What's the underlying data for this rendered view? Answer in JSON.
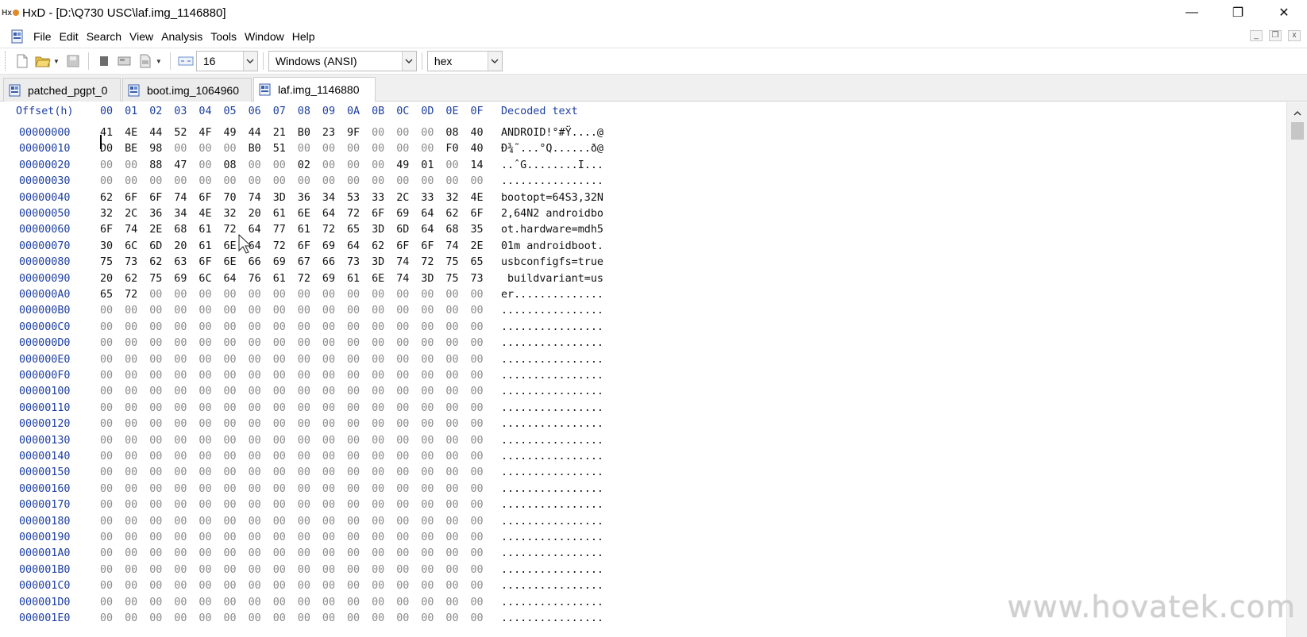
{
  "window": {
    "title": "HxD - [D:\\Q730 USC\\laf.img_1146880]",
    "minimize": "—",
    "restore": "❐",
    "close": "✕"
  },
  "menu": {
    "items": [
      "File",
      "Edit",
      "Search",
      "View",
      "Analysis",
      "Tools",
      "Window",
      "Help"
    ]
  },
  "mdi": {
    "minimize": "_",
    "restore": "❐",
    "close": "x"
  },
  "toolbar": {
    "bytes_per_row": "16",
    "charset": "Windows (ANSI)",
    "offset_base": "hex"
  },
  "tabs": [
    {
      "label": "patched_pgpt_0"
    },
    {
      "label": "boot.img_1064960"
    },
    {
      "label": "laf.img_1146880"
    }
  ],
  "hex": {
    "header_offset": "Offset(h)",
    "header_columns": [
      "00",
      "01",
      "02",
      "03",
      "04",
      "05",
      "06",
      "07",
      "08",
      "09",
      "0A",
      "0B",
      "0C",
      "0D",
      "0E",
      "0F"
    ],
    "header_decoded": "Decoded text",
    "rows": [
      {
        "off": "00000000",
        "bytes": [
          "41",
          "4E",
          "44",
          "52",
          "4F",
          "49",
          "44",
          "21",
          "B0",
          "23",
          "9F",
          "00",
          "00",
          "00",
          "08",
          "40"
        ],
        "dec": "ANDROID!°#Ÿ....@"
      },
      {
        "off": "00000010",
        "bytes": [
          "D0",
          "BE",
          "98",
          "00",
          "00",
          "00",
          "B0",
          "51",
          "00",
          "00",
          "00",
          "00",
          "00",
          "00",
          "F0",
          "40"
        ],
        "dec": "Ð¾˜...°Q......ð@"
      },
      {
        "off": "00000020",
        "bytes": [
          "00",
          "00",
          "88",
          "47",
          "00",
          "08",
          "00",
          "00",
          "02",
          "00",
          "00",
          "00",
          "49",
          "01",
          "00",
          "14"
        ],
        "dec": "..ˆG........I..."
      },
      {
        "off": "00000030",
        "bytes": [
          "00",
          "00",
          "00",
          "00",
          "00",
          "00",
          "00",
          "00",
          "00",
          "00",
          "00",
          "00",
          "00",
          "00",
          "00",
          "00"
        ],
        "dec": "................"
      },
      {
        "off": "00000040",
        "bytes": [
          "62",
          "6F",
          "6F",
          "74",
          "6F",
          "70",
          "74",
          "3D",
          "36",
          "34",
          "53",
          "33",
          "2C",
          "33",
          "32",
          "4E"
        ],
        "dec": "bootopt=64S3,32N"
      },
      {
        "off": "00000050",
        "bytes": [
          "32",
          "2C",
          "36",
          "34",
          "4E",
          "32",
          "20",
          "61",
          "6E",
          "64",
          "72",
          "6F",
          "69",
          "64",
          "62",
          "6F"
        ],
        "dec": "2,64N2 androidbo"
      },
      {
        "off": "00000060",
        "bytes": [
          "6F",
          "74",
          "2E",
          "68",
          "61",
          "72",
          "64",
          "77",
          "61",
          "72",
          "65",
          "3D",
          "6D",
          "64",
          "68",
          "35"
        ],
        "dec": "ot.hardware=mdh5"
      },
      {
        "off": "00000070",
        "bytes": [
          "30",
          "6C",
          "6D",
          "20",
          "61",
          "6E",
          "64",
          "72",
          "6F",
          "69",
          "64",
          "62",
          "6F",
          "6F",
          "74",
          "2E"
        ],
        "dec": "01m androidboot."
      },
      {
        "off": "00000080",
        "bytes": [
          "75",
          "73",
          "62",
          "63",
          "6F",
          "6E",
          "66",
          "69",
          "67",
          "66",
          "73",
          "3D",
          "74",
          "72",
          "75",
          "65"
        ],
        "dec": "usbconfigfs=true"
      },
      {
        "off": "00000090",
        "bytes": [
          "20",
          "62",
          "75",
          "69",
          "6C",
          "64",
          "76",
          "61",
          "72",
          "69",
          "61",
          "6E",
          "74",
          "3D",
          "75",
          "73"
        ],
        "dec": " buildvariant=us"
      },
      {
        "off": "000000A0",
        "bytes": [
          "65",
          "72",
          "00",
          "00",
          "00",
          "00",
          "00",
          "00",
          "00",
          "00",
          "00",
          "00",
          "00",
          "00",
          "00",
          "00"
        ],
        "dec": "er.............."
      },
      {
        "off": "000000B0",
        "bytes": [
          "00",
          "00",
          "00",
          "00",
          "00",
          "00",
          "00",
          "00",
          "00",
          "00",
          "00",
          "00",
          "00",
          "00",
          "00",
          "00"
        ],
        "dec": "................"
      },
      {
        "off": "000000C0",
        "bytes": [
          "00",
          "00",
          "00",
          "00",
          "00",
          "00",
          "00",
          "00",
          "00",
          "00",
          "00",
          "00",
          "00",
          "00",
          "00",
          "00"
        ],
        "dec": "................"
      },
      {
        "off": "000000D0",
        "bytes": [
          "00",
          "00",
          "00",
          "00",
          "00",
          "00",
          "00",
          "00",
          "00",
          "00",
          "00",
          "00",
          "00",
          "00",
          "00",
          "00"
        ],
        "dec": "................"
      },
      {
        "off": "000000E0",
        "bytes": [
          "00",
          "00",
          "00",
          "00",
          "00",
          "00",
          "00",
          "00",
          "00",
          "00",
          "00",
          "00",
          "00",
          "00",
          "00",
          "00"
        ],
        "dec": "................"
      },
      {
        "off": "000000F0",
        "bytes": [
          "00",
          "00",
          "00",
          "00",
          "00",
          "00",
          "00",
          "00",
          "00",
          "00",
          "00",
          "00",
          "00",
          "00",
          "00",
          "00"
        ],
        "dec": "................"
      },
      {
        "off": "00000100",
        "bytes": [
          "00",
          "00",
          "00",
          "00",
          "00",
          "00",
          "00",
          "00",
          "00",
          "00",
          "00",
          "00",
          "00",
          "00",
          "00",
          "00"
        ],
        "dec": "................"
      },
      {
        "off": "00000110",
        "bytes": [
          "00",
          "00",
          "00",
          "00",
          "00",
          "00",
          "00",
          "00",
          "00",
          "00",
          "00",
          "00",
          "00",
          "00",
          "00",
          "00"
        ],
        "dec": "................"
      },
      {
        "off": "00000120",
        "bytes": [
          "00",
          "00",
          "00",
          "00",
          "00",
          "00",
          "00",
          "00",
          "00",
          "00",
          "00",
          "00",
          "00",
          "00",
          "00",
          "00"
        ],
        "dec": "................"
      },
      {
        "off": "00000130",
        "bytes": [
          "00",
          "00",
          "00",
          "00",
          "00",
          "00",
          "00",
          "00",
          "00",
          "00",
          "00",
          "00",
          "00",
          "00",
          "00",
          "00"
        ],
        "dec": "................"
      },
      {
        "off": "00000140",
        "bytes": [
          "00",
          "00",
          "00",
          "00",
          "00",
          "00",
          "00",
          "00",
          "00",
          "00",
          "00",
          "00",
          "00",
          "00",
          "00",
          "00"
        ],
        "dec": "................"
      },
      {
        "off": "00000150",
        "bytes": [
          "00",
          "00",
          "00",
          "00",
          "00",
          "00",
          "00",
          "00",
          "00",
          "00",
          "00",
          "00",
          "00",
          "00",
          "00",
          "00"
        ],
        "dec": "................"
      },
      {
        "off": "00000160",
        "bytes": [
          "00",
          "00",
          "00",
          "00",
          "00",
          "00",
          "00",
          "00",
          "00",
          "00",
          "00",
          "00",
          "00",
          "00",
          "00",
          "00"
        ],
        "dec": "................"
      },
      {
        "off": "00000170",
        "bytes": [
          "00",
          "00",
          "00",
          "00",
          "00",
          "00",
          "00",
          "00",
          "00",
          "00",
          "00",
          "00",
          "00",
          "00",
          "00",
          "00"
        ],
        "dec": "................"
      },
      {
        "off": "00000180",
        "bytes": [
          "00",
          "00",
          "00",
          "00",
          "00",
          "00",
          "00",
          "00",
          "00",
          "00",
          "00",
          "00",
          "00",
          "00",
          "00",
          "00"
        ],
        "dec": "................"
      },
      {
        "off": "00000190",
        "bytes": [
          "00",
          "00",
          "00",
          "00",
          "00",
          "00",
          "00",
          "00",
          "00",
          "00",
          "00",
          "00",
          "00",
          "00",
          "00",
          "00"
        ],
        "dec": "................"
      },
      {
        "off": "000001A0",
        "bytes": [
          "00",
          "00",
          "00",
          "00",
          "00",
          "00",
          "00",
          "00",
          "00",
          "00",
          "00",
          "00",
          "00",
          "00",
          "00",
          "00"
        ],
        "dec": "................"
      },
      {
        "off": "000001B0",
        "bytes": [
          "00",
          "00",
          "00",
          "00",
          "00",
          "00",
          "00",
          "00",
          "00",
          "00",
          "00",
          "00",
          "00",
          "00",
          "00",
          "00"
        ],
        "dec": "................"
      },
      {
        "off": "000001C0",
        "bytes": [
          "00",
          "00",
          "00",
          "00",
          "00",
          "00",
          "00",
          "00",
          "00",
          "00",
          "00",
          "00",
          "00",
          "00",
          "00",
          "00"
        ],
        "dec": "................"
      },
      {
        "off": "000001D0",
        "bytes": [
          "00",
          "00",
          "00",
          "00",
          "00",
          "00",
          "00",
          "00",
          "00",
          "00",
          "00",
          "00",
          "00",
          "00",
          "00",
          "00"
        ],
        "dec": "................"
      },
      {
        "off": "000001E0",
        "bytes": [
          "00",
          "00",
          "00",
          "00",
          "00",
          "00",
          "00",
          "00",
          "00",
          "00",
          "00",
          "00",
          "00",
          "00",
          "00",
          "00"
        ],
        "dec": "................"
      }
    ]
  },
  "watermark": "www.hovatek.com",
  "colors": {
    "offset_blue": "#1d3fa0",
    "zero_byte_gray": "#8a8a8a",
    "byte_black": "#111111"
  }
}
